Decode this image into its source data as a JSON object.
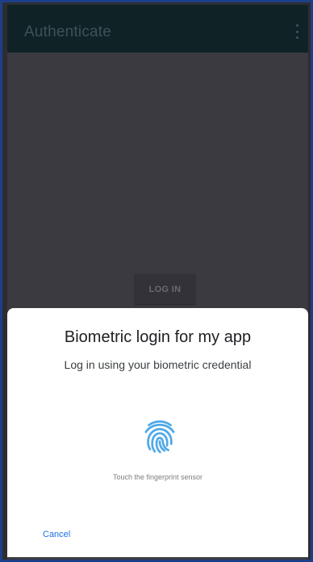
{
  "app_bar": {
    "title": "Authenticate",
    "overflow_icon": "more-vert-icon"
  },
  "main": {
    "login_button_label": "LOG IN"
  },
  "biometric_prompt": {
    "title": "Biometric login for my app",
    "subtitle": "Log in using your biometric credential",
    "icon": "fingerprint-icon",
    "hint": "Touch the fingerprint sensor",
    "cancel_label": "Cancel"
  },
  "colors": {
    "accent": "#1a73e8",
    "fingerprint": "#4fa8e8",
    "app_bar": "#0f2226"
  }
}
